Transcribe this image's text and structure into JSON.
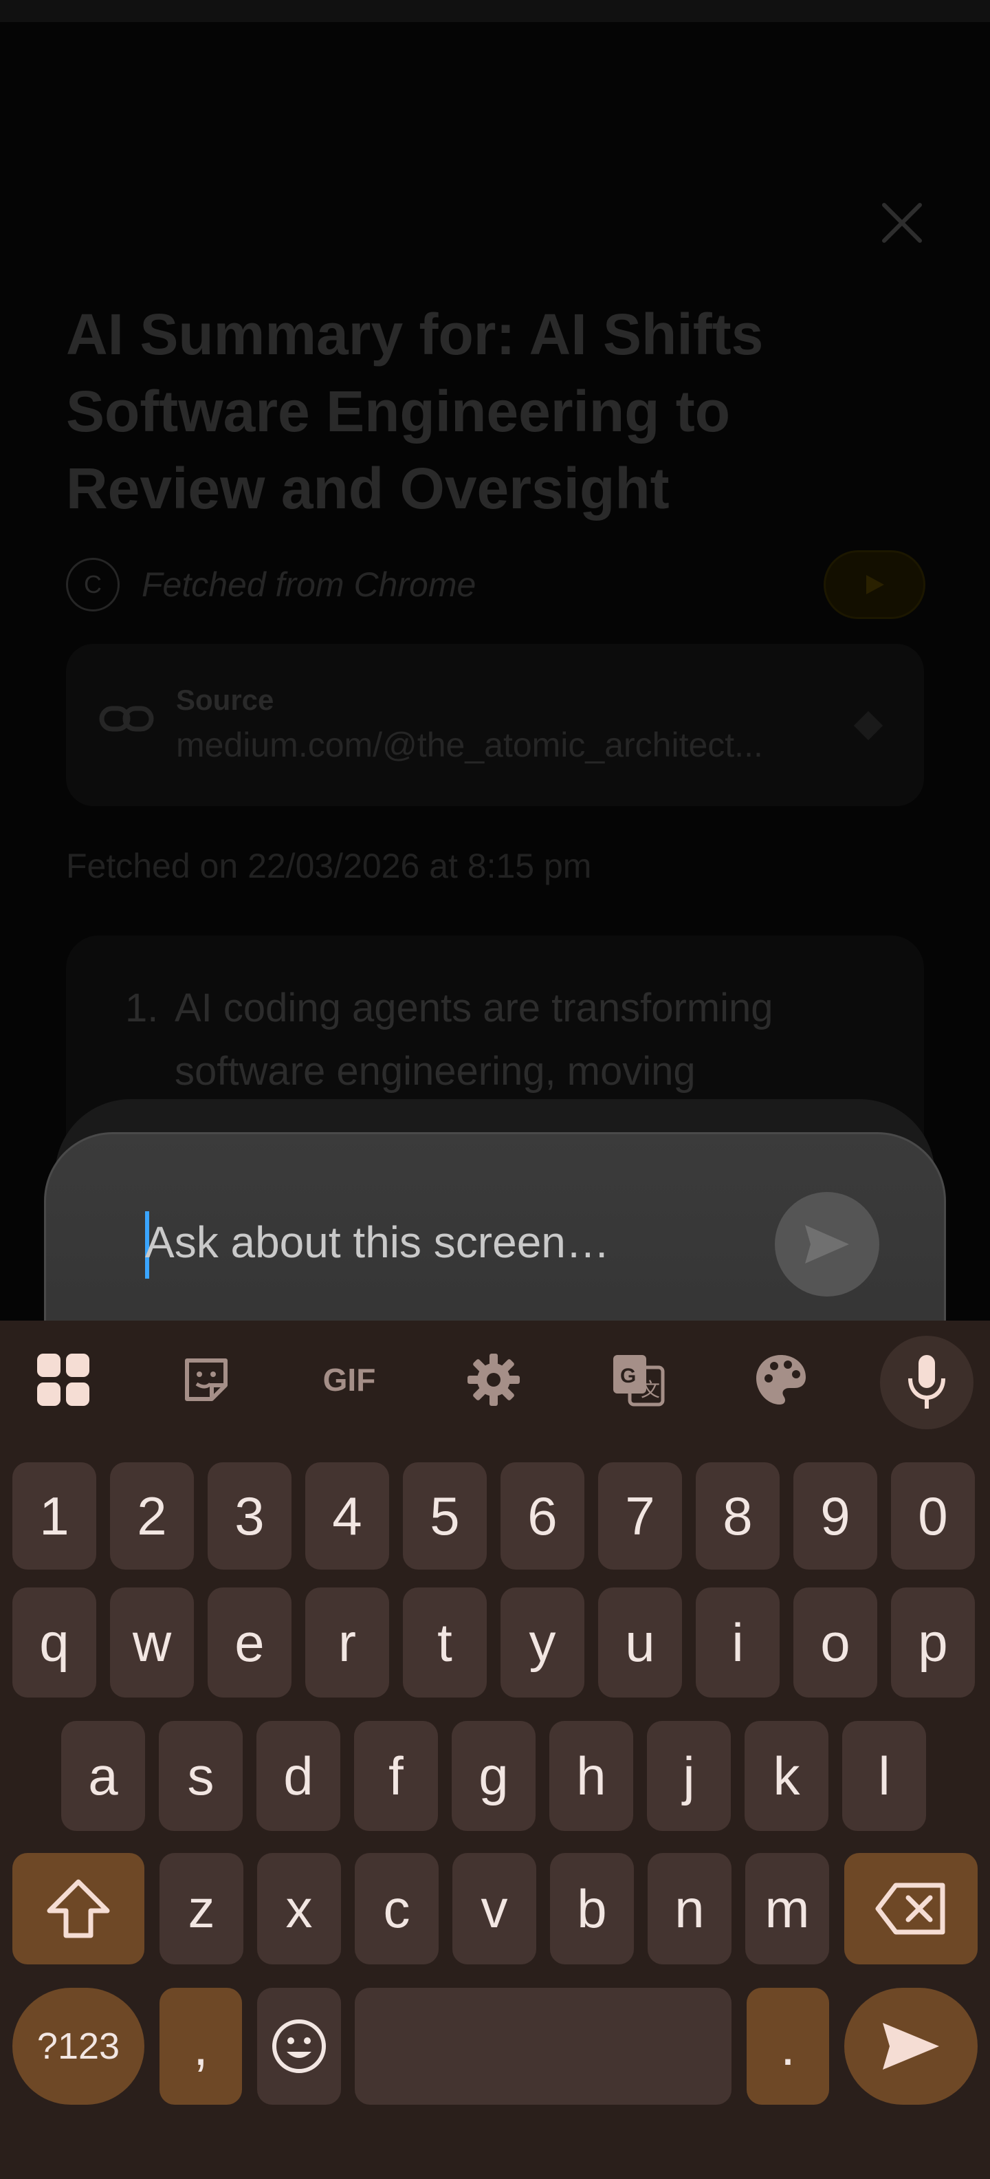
{
  "background": {
    "title": "AI Summary for: AI Shifts Software Engineering to Review and Oversight",
    "fetched_from_icon_letter": "C",
    "fetched_from": "Fetched from Chrome",
    "source": {
      "label": "Source",
      "url": "medium.com/@the_atomic_architect..."
    },
    "fetched_on": "Fetched on 22/03/2026 at 8:15 pm",
    "summary": {
      "item_number": "1.",
      "line1": "AI coding agents are transforming",
      "line2": "software engineering, moving"
    }
  },
  "chat_input": {
    "placeholder": "Ask about this screen…"
  },
  "keyboard": {
    "toolbar_icons": [
      "apps-grid-icon",
      "sticker-icon",
      "gif-icon",
      "settings-gear-icon",
      "translate-icon",
      "palette-icon",
      "mic-icon"
    ],
    "toolbar_gif_label": "GIF",
    "row_numbers": [
      "1",
      "2",
      "3",
      "4",
      "5",
      "6",
      "7",
      "8",
      "9",
      "0"
    ],
    "row_qwerty": [
      "q",
      "w",
      "e",
      "r",
      "t",
      "y",
      "u",
      "i",
      "o",
      "p"
    ],
    "row_asdf": [
      "a",
      "s",
      "d",
      "f",
      "g",
      "h",
      "j",
      "k",
      "l"
    ],
    "row_zxcv": [
      "z",
      "x",
      "c",
      "v",
      "b",
      "n",
      "m"
    ],
    "symbols_label": "?123",
    "comma_label": ",",
    "period_label": ".",
    "accent_color": "#6e4826",
    "key_color": "#443430",
    "background_color": "#2a1f1b"
  }
}
